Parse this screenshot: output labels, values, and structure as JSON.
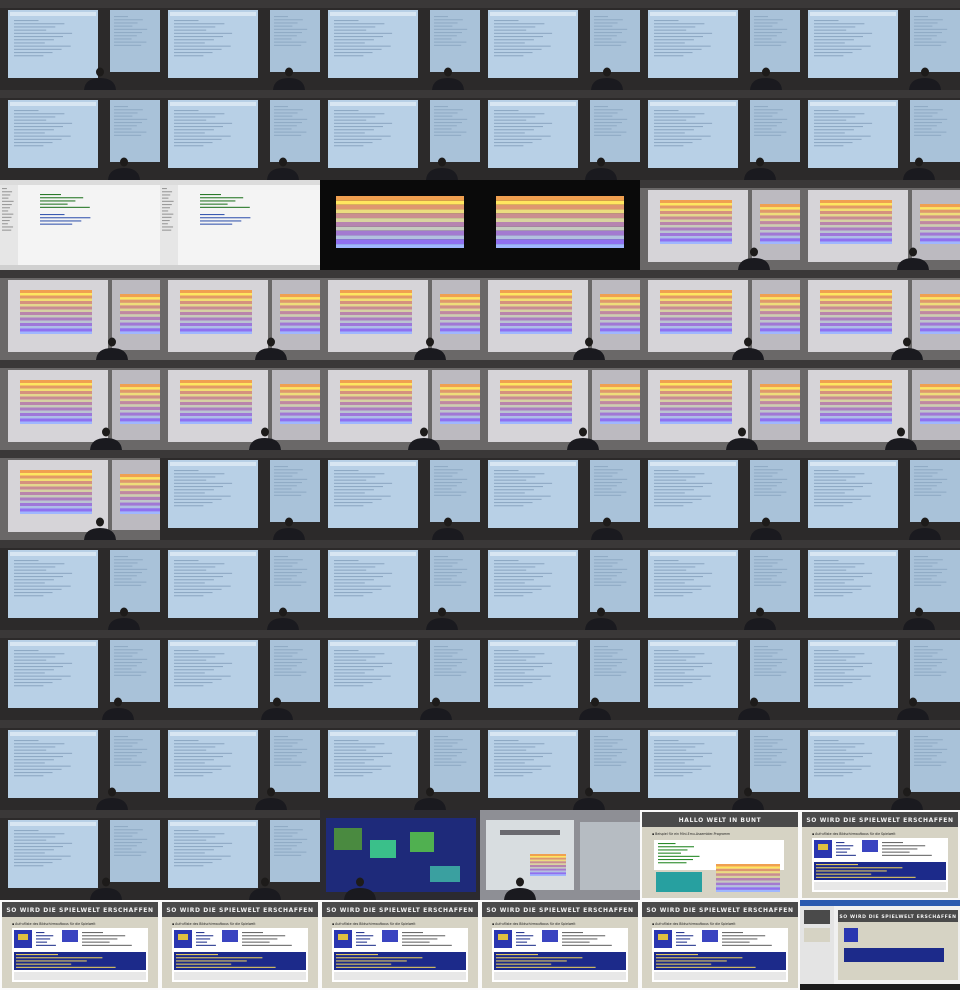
{
  "contact_sheet": {
    "columns": 6,
    "rows": 11,
    "tiles": [
      "lecture-code",
      "lecture-code",
      "lecture-code",
      "lecture-code",
      "lecture-code",
      "lecture-code",
      "lecture-code",
      "lecture-code",
      "lecture-code",
      "lecture-code",
      "lecture-code",
      "lecture-code",
      "editor-screenshot",
      "editor-screenshot",
      "rainbow-bars",
      "rainbow-bars",
      "lecture-rainbow",
      "lecture-rainbow",
      "lecture-rainbow",
      "lecture-rainbow",
      "lecture-rainbow",
      "lecture-rainbow",
      "lecture-rainbow",
      "lecture-rainbow",
      "lecture-rainbow",
      "lecture-rainbow",
      "lecture-rainbow",
      "lecture-rainbow",
      "lecture-rainbow",
      "lecture-rainbow",
      "lecture-rainbow",
      "lecture-code",
      "lecture-code",
      "lecture-code",
      "lecture-code",
      "lecture-code",
      "lecture-code",
      "lecture-code",
      "lecture-code",
      "lecture-code",
      "lecture-code",
      "lecture-code",
      "lecture-code",
      "lecture-code",
      "lecture-code",
      "lecture-code",
      "lecture-code",
      "lecture-code",
      "lecture-code",
      "lecture-code",
      "lecture-code",
      "lecture-code",
      "lecture-code",
      "lecture-code",
      "lecture-code",
      "lecture-code",
      "lecture-game",
      "lecture-slide",
      "slide-hallo",
      "slide-spielwelt",
      "slide-spielwelt",
      "slide-spielwelt",
      "slide-spielwelt",
      "slide-spielwelt",
      "slide-spielwelt",
      "desktop-slide"
    ]
  },
  "slides": {
    "hallo_title": "HALLO WELT IN BUNT",
    "spielwelt_title": "SO WIRD DIE SPIELWELT ERSCHAFFEN",
    "hallo_bullet": "Beispiel für ein Mini-Emu-Assembler-Programm",
    "spielwelt_bullet": "Aufrufliste des Bildschirmaufbaus für die Spielwelt"
  },
  "colors": {
    "slide_header": "#4a4a4a",
    "slide_body": "#d6d3c4",
    "projector_blue": "#b8d0e6",
    "raster_bar_top": "#f0a050",
    "raster_bar_bottom": "#9070f0"
  }
}
